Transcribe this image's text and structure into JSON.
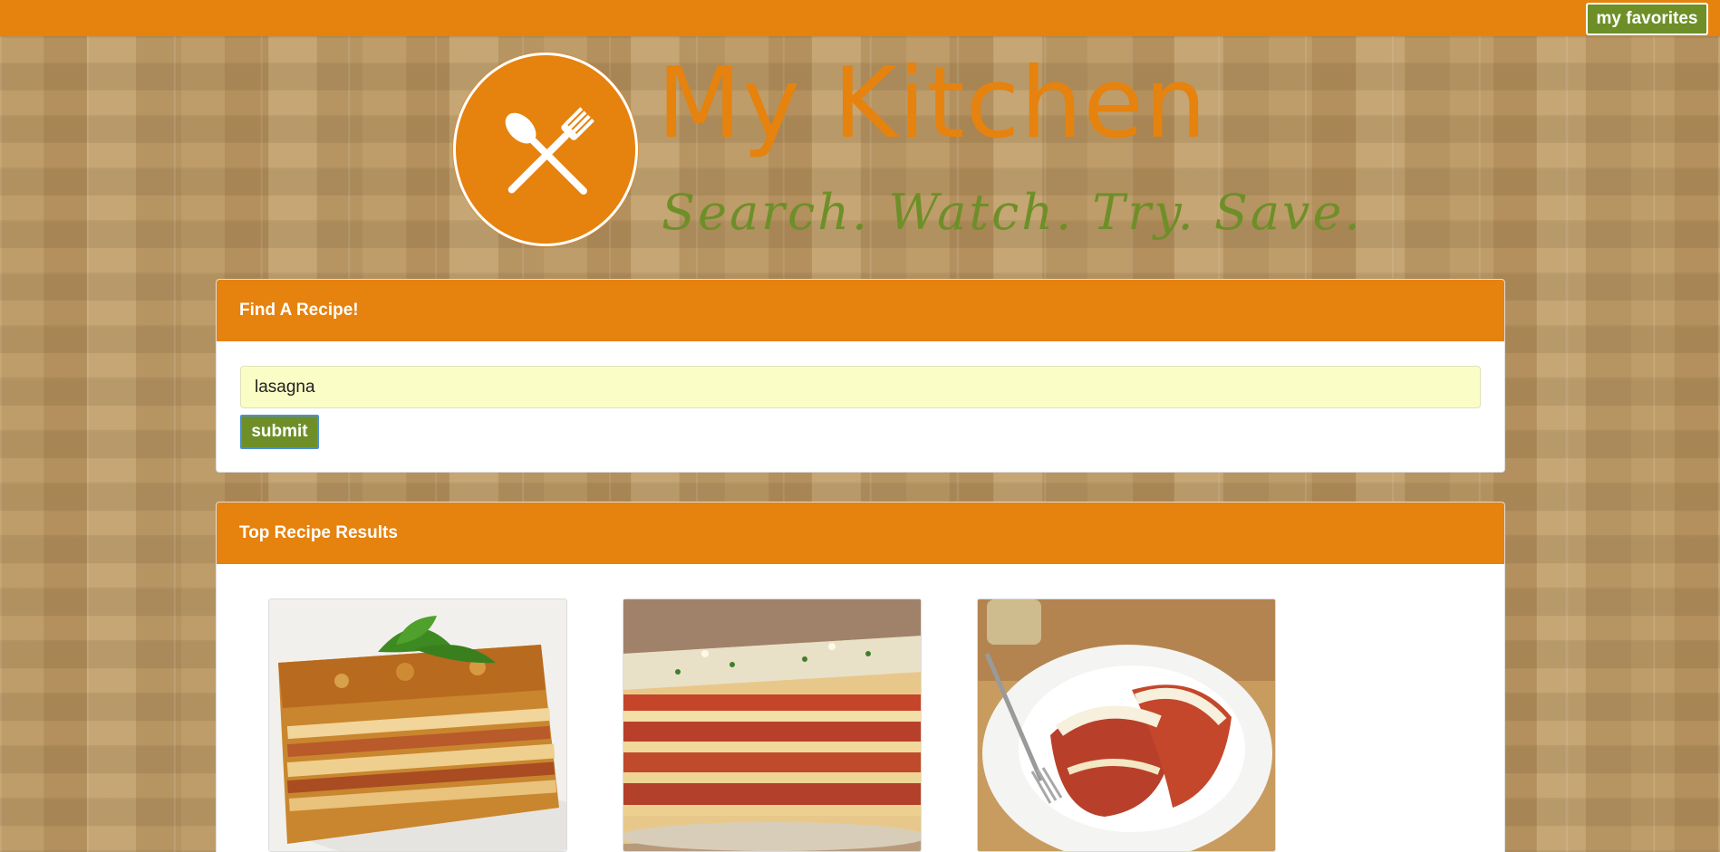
{
  "header": {
    "favorites_label": "my favorites"
  },
  "logo": {
    "title": "My Kitchen",
    "tagline": "Search. Watch. Try. Save."
  },
  "search": {
    "heading": "Find A Recipe!",
    "value": "lasagna",
    "submit_label": "submit"
  },
  "results": {
    "heading": "Top Recipe Results",
    "items": [
      {
        "image": "lasagna-with-basil-photo"
      },
      {
        "image": "layered-lasagna-photo"
      },
      {
        "image": "lasagna-roll-ups-photo"
      }
    ]
  },
  "colors": {
    "brand_orange": "#e6820e",
    "brand_green": "#6e8f28",
    "input_bg": "#fafdc5"
  }
}
